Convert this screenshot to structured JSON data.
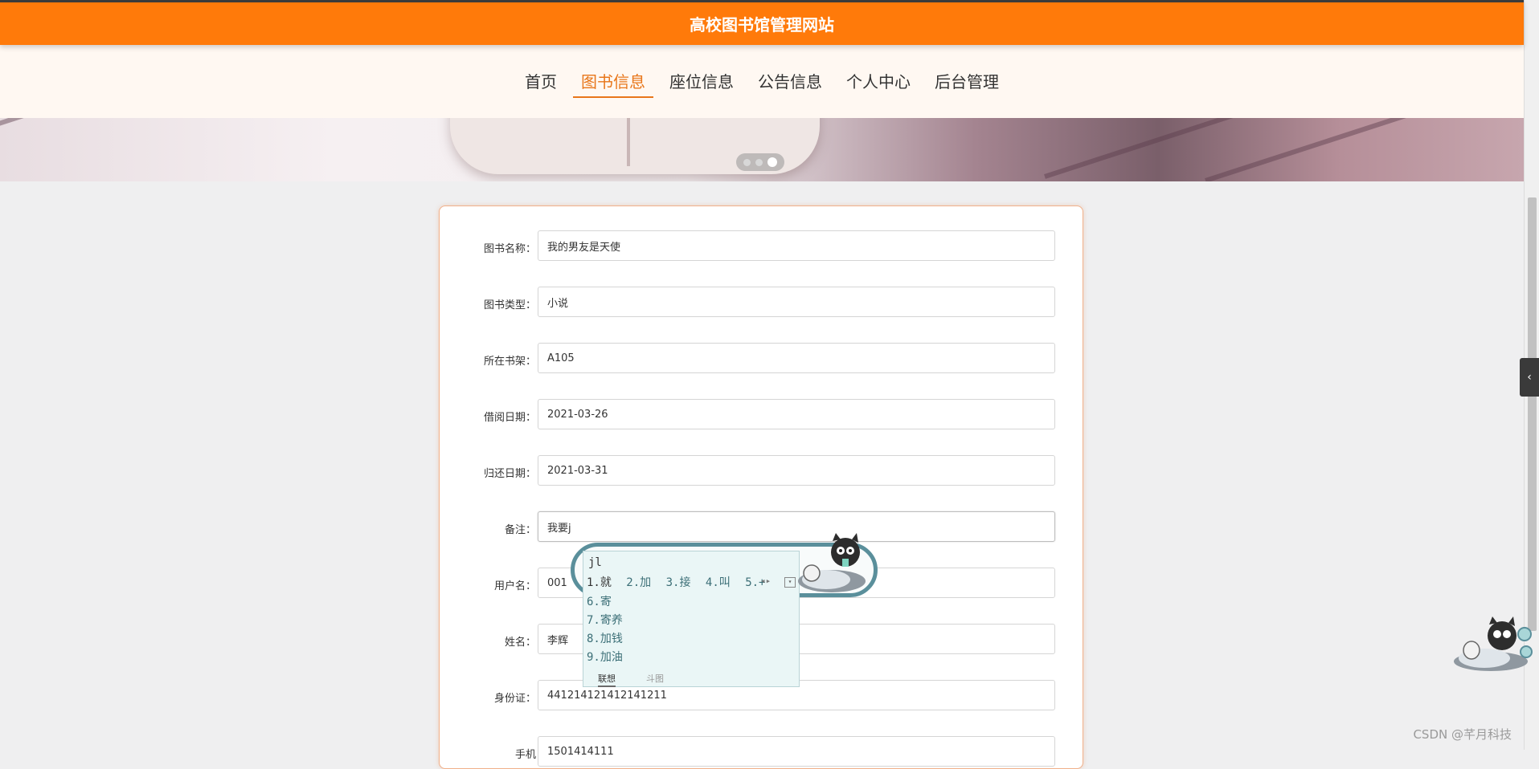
{
  "header": {
    "site_title": "高校图书馆管理网站"
  },
  "nav": {
    "items": [
      {
        "label": "首页"
      },
      {
        "label": "图书信息",
        "active": true
      },
      {
        "label": "座位信息"
      },
      {
        "label": "公告信息"
      },
      {
        "label": "个人中心"
      },
      {
        "label": "后台管理"
      }
    ]
  },
  "carousel": {
    "slide_count": 3,
    "active_index": 3
  },
  "form": {
    "fields": [
      {
        "label": "图书名称：",
        "value": "我的男友是天使"
      },
      {
        "label": "图书类型：",
        "value": "小说"
      },
      {
        "label": "所在书架：",
        "value": "A105"
      },
      {
        "label": "借阅日期：",
        "value": "2021-03-26"
      },
      {
        "label": "归还日期：",
        "value": "2021-03-31"
      },
      {
        "label": "备注：",
        "value": "我要j"
      },
      {
        "label": "用户名：",
        "value": "001"
      },
      {
        "label": "姓名：",
        "value": "李辉"
      },
      {
        "label": "身份证：",
        "value": "441214121412141211"
      },
      {
        "label": "手机",
        "value": "1501414111"
      }
    ]
  },
  "ime": {
    "pinyin": "jl",
    "row1": [
      "1.就",
      "2.加",
      "3.接",
      "4.叫",
      "5.+"
    ],
    "candidates": [
      "6.寄",
      "7.寄养",
      "8.加钱",
      "9.加油"
    ],
    "tabs": [
      "联想",
      "斗图"
    ]
  },
  "watermark": "CSDN @芊月科技",
  "colors": {
    "brand": "#ff7a0a",
    "nav_active": "#e8761a",
    "ime_border": "#5a8f9b"
  }
}
